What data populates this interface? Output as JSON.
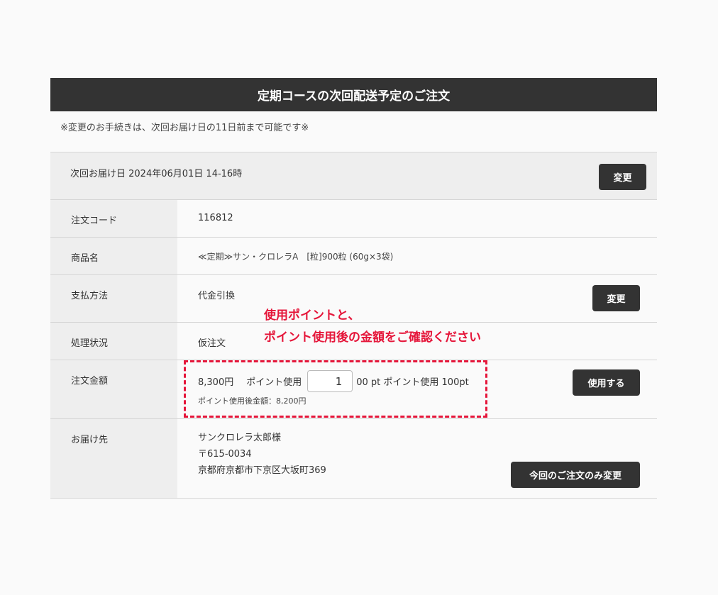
{
  "title": "定期コースの次回配送予定のご注文",
  "notice": "※変更のお手続きは、次回お届け日の11日前まで可能です※",
  "delivery": {
    "text": "次回お届け日 2024年06月01日 14-16時",
    "change_label": "変更"
  },
  "rows": {
    "order_code": {
      "label": "注文コード",
      "value": "116812"
    },
    "product": {
      "label": "商品名",
      "value": "≪定期≫サン・クロレラA　[粒]900粒 (60g×3袋)"
    },
    "payment": {
      "label": "支払方法",
      "value": "代金引換",
      "change_label": "変更"
    },
    "status": {
      "label": "処理状況",
      "value": "仮注文"
    },
    "amount": {
      "label": "注文金額",
      "price": "8,300円",
      "point_use_label": "ポイント使用",
      "point_input_value": "1",
      "point_suffix": "00 pt ポイント使用 100pt",
      "after_amount": "ポイント使用後金額：8,200円",
      "use_label": "使用する"
    },
    "address": {
      "label": "お届け先",
      "name": "サンクロレラ太郎様",
      "zip": "〒615-0034",
      "addr": "京都府京都市下京区大坂町369",
      "change_label": "今回のご注文のみ変更"
    }
  },
  "annotation": {
    "line1": "使用ポイントと、",
    "line2": "ポイント使用後の金額をご確認ください"
  },
  "colors": {
    "header_bg": "#333333",
    "accent_red": "#e5163a",
    "label_bg": "#eeeeee"
  }
}
